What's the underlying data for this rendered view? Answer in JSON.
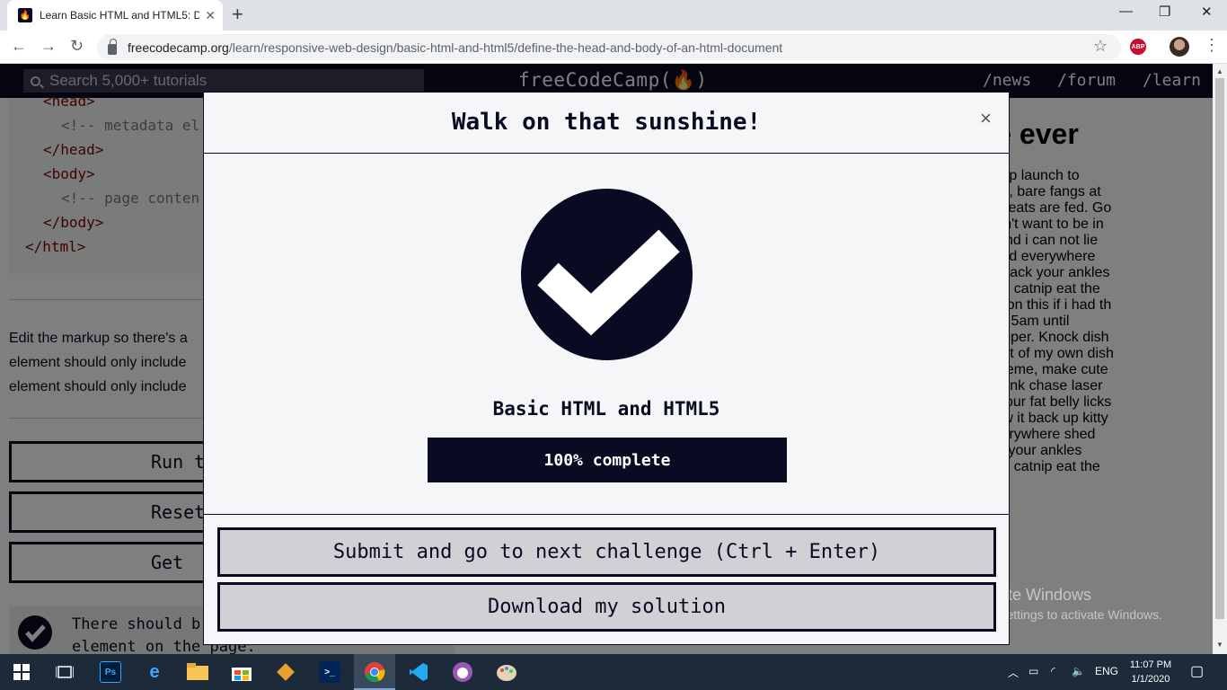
{
  "browser": {
    "tab_title": "Learn Basic HTML and HTML5: D",
    "tab_close": "✕",
    "new_tab": "+",
    "url_host": "freecodecamp.org",
    "url_path": "/learn/responsive-web-design/basic-html-and-html5/define-the-head-and-body-of-an-html-document",
    "window_controls": {
      "minimize": "—",
      "restore": "❐",
      "close": "✕"
    },
    "back": "←",
    "forward": "→",
    "reload": "↻",
    "bookmark": "☆",
    "menu": "⋮",
    "abp_label": "ABP"
  },
  "fcc_nav": {
    "search_placeholder": "Search 5,000+ tutorials",
    "brand": "freeCodeCamp(🔥)",
    "links": [
      "/news",
      "/forum",
      "/learn"
    ]
  },
  "editor": {
    "lines": [
      {
        "tag": "<head>",
        "comment": ""
      },
      {
        "tag": "",
        "comment": "<!-- metadata el"
      },
      {
        "tag": "</head>",
        "comment": ""
      },
      {
        "tag": "<body>",
        "comment": ""
      },
      {
        "tag": "",
        "comment": "<!-- page conten"
      },
      {
        "tag": "</body>",
        "comment": ""
      },
      {
        "tag": "</html>",
        "comment": ""
      }
    ]
  },
  "instructions": {
    "lines": [
      "Edit the markup so there's a",
      "element should only include",
      "element should only include"
    ]
  },
  "action_buttons": [
    "Run t",
    "Reset",
    "Get"
  ],
  "test": {
    "line1": "There should b",
    "line2": "element on the page."
  },
  "preview": {
    "heading": "st page ever",
    "paragraph": "or sit amet, jump launch to\nttle yarn mouse, bare fangs at\nlitter box until treats are fed. Go\ndecide you didn't want to be in\nl like big cats and i can not lie\nor sit amet, shed everywhere\nre stretching attack your ankles\ndot, hairball run catnip eat the\now i could pee on this if i had th\n owner's face at 5am until\nd dish yet scamper. Knock dish\nbutt cant eat out of my own dish\nniture. Make meme, make cute\nthe bathroom sink chase laser\nshoe. Paw at your fat belly licks\neat grass, throw it back up kitty\n amet, shed everywhere shed\nretching attack your ankles\ndot, hairball run catnip eat the"
  },
  "modal": {
    "title": "Walk on that sunshine!",
    "close": "×",
    "block_name": "Basic HTML and HTML5",
    "progress_percent": 100,
    "progress_label": "100% complete",
    "submit_button": "Submit and go to next challenge (Ctrl + Enter)",
    "download_button": "Download my solution"
  },
  "watermark": {
    "line1": "Activate Windows",
    "line2": "Go to Settings to activate Windows."
  },
  "taskbar": {
    "icons": [
      "windows-start",
      "task-view",
      "photoshop",
      "edge",
      "file-explorer",
      "store",
      "git",
      "powershell",
      "chrome",
      "vscode",
      "github-desktop",
      "paint"
    ],
    "ps_label": "Ps",
    "language": "ENG",
    "time": "11:07 PM",
    "date": "1/1/2020"
  },
  "colors": {
    "fcc_dark": "#0a0a23",
    "modal_bg": "#f5f6f7",
    "button_gray": "#d0d0d5"
  }
}
